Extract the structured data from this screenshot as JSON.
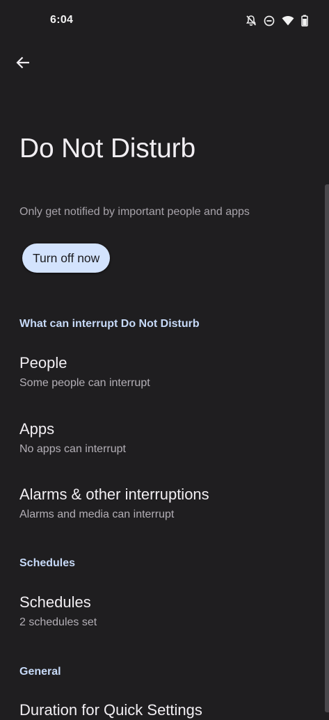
{
  "status_bar": {
    "time": "6:04",
    "icons": [
      "notifications-off-icon",
      "do-not-disturb-icon",
      "wifi-icon",
      "battery-icon"
    ]
  },
  "toolbar": {
    "back_icon": "arrow-back-icon"
  },
  "page": {
    "title": "Do Not Disturb",
    "description": "Only get notified by important people and apps",
    "turn_off_label": "Turn off now"
  },
  "sections": [
    {
      "header": "What can interrupt Do Not Disturb",
      "items": [
        {
          "title": "People",
          "summary": "Some people can interrupt"
        },
        {
          "title": "Apps",
          "summary": "No apps can interrupt"
        },
        {
          "title": "Alarms & other interruptions",
          "summary": "Alarms and media can interrupt"
        }
      ]
    },
    {
      "header": "Schedules",
      "items": [
        {
          "title": "Schedules",
          "summary": "2 schedules set"
        }
      ]
    },
    {
      "header": "General",
      "items": [
        {
          "title": "Duration for Quick Settings",
          "summary": ""
        }
      ]
    }
  ],
  "colors": {
    "background": "#1f1e20",
    "accent_button": "#d3e3fd",
    "section_header": "#c7daf8"
  }
}
